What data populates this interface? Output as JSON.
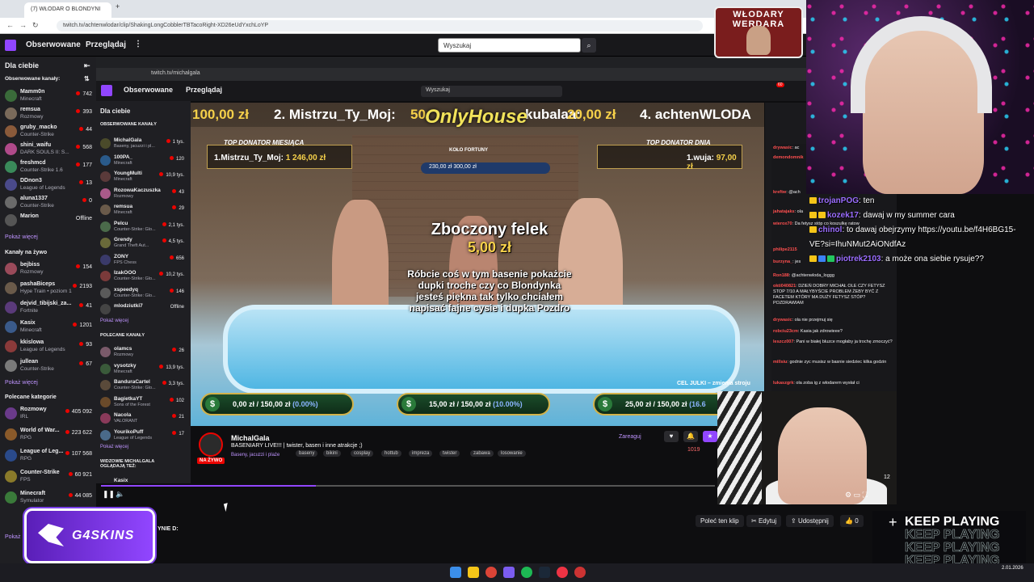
{
  "browser": {
    "tab_title": "(7) WŁODAR O BLONDYNI",
    "url": "twitch.tv/achtenwlodar/clip/ShakingLongCobblerTBTacoRight-XD26eUdYxchLoYP",
    "new_tab": "+"
  },
  "twitch_nav": {
    "following": "Obserwowane",
    "browse": "Przeglądaj",
    "more": "⋮",
    "search_placeholder": "Wyszukaj"
  },
  "sidebar": {
    "for_you": "Dla ciebie",
    "collapse": "⇤",
    "followed_label": "Obserwowane kanały:",
    "followed": [
      {
        "name": "Mamm0n",
        "game": "Minecraft",
        "viewers": "742",
        "color": "#3a6b3a"
      },
      {
        "name": "remsua",
        "game": "Rozmowy",
        "viewers": "393",
        "color": "#7a6a5a"
      },
      {
        "name": "gruby_macko",
        "game": "Counter-Strike",
        "viewers": "44",
        "color": "#8a5a3a"
      },
      {
        "name": "shini_waifu",
        "game": "DARK SOULS II: S...",
        "viewers": "568",
        "color": "#b04a8a"
      },
      {
        "name": "freshmcd",
        "game": "Counter-Strike 1.6",
        "viewers": "177",
        "color": "#3a8a5a"
      },
      {
        "name": "DDnon3",
        "game": "League of Legends",
        "viewers": "13",
        "color": "#4a4a8a"
      },
      {
        "name": "aluna1337",
        "game": "Counter-Strike",
        "viewers": "0",
        "color": "#6a6a6a"
      },
      {
        "name": "Marion",
        "game": "",
        "viewers": "Offline",
        "color": "#555555"
      }
    ],
    "show_more_1": "Pokaż więcej",
    "live_label": "Kanały na żywo",
    "live": [
      {
        "name": "bejbiss",
        "game": "Rozmowy",
        "viewers": "154",
        "color": "#9a4a5a"
      },
      {
        "name": "pashaBiceps",
        "game": "Hype Train • poziom 1",
        "viewers": "2193",
        "color": "#6a5a4a"
      },
      {
        "name": "dejvid_tibijski_za...",
        "game": "Fortnite",
        "viewers": "41",
        "color": "#5a3a7a"
      },
      {
        "name": "Kasix",
        "game": "Minecraft",
        "viewers": "1201",
        "color": "#3a5a8a"
      },
      {
        "name": "kkislowa",
        "game": "League of Legends",
        "viewers": "93",
        "color": "#8a3a3a"
      },
      {
        "name": "jullean",
        "game": "Counter-Strike",
        "viewers": "67",
        "color": "#7a7a7a"
      }
    ],
    "show_more_2": "Pokaż więcej",
    "categories_label": "Polecane kategorie",
    "categories": [
      {
        "name": "Rozmowy",
        "tag": "IRL",
        "viewers": "405 092",
        "color": "#6a3a8a"
      },
      {
        "name": "World of War...",
        "tag": "RPG",
        "viewers": "223 622",
        "color": "#8a5a2a"
      },
      {
        "name": "League of Leg...",
        "tag": "RPG",
        "viewers": "107 568",
        "color": "#2a4a8a"
      },
      {
        "name": "Counter-Strike",
        "tag": "FPS",
        "viewers": "60 921",
        "color": "#8a7a2a"
      },
      {
        "name": "Minecraft",
        "tag": "Symulator",
        "viewers": "44 085",
        "color": "#3a7a3a"
      }
    ],
    "show_more_3": "Pokaż"
  },
  "inner": {
    "url": "twitch.tv/michalgala",
    "following": "Obserwowane",
    "browse": "Przeglądaj",
    "search_placeholder": "Wyszukaj",
    "notif_count": "60",
    "for_you": "Dla ciebie",
    "followed_label": "OBSERWOWANE KANAŁY",
    "followed": [
      {
        "name": "MichalGala",
        "game": "Baseny, jacuzzi i pl...",
        "viewers": "1 tys.",
        "color": "#4a4a2a"
      },
      {
        "name": "100PA_",
        "game": "Minecraft",
        "viewers": "120",
        "color": "#2a5a8a"
      },
      {
        "name": "YoungMulti",
        "game": "Minecraft",
        "viewers": "10,9 tys.",
        "color": "#5a3a3a"
      },
      {
        "name": "RozowaKaczuszka",
        "game": "Rozmowy",
        "viewers": "43",
        "color": "#aa5a8a"
      },
      {
        "name": "remsua",
        "game": "Minecraft",
        "viewers": "29",
        "color": "#6a5a4a"
      },
      {
        "name": "Pelcu",
        "game": "Counter-Strike: Glo...",
        "viewers": "2,1 tys.",
        "color": "#4a6a4a"
      },
      {
        "name": "Grendy",
        "game": "Grand Theft Aut...",
        "viewers": "4,5 tys.",
        "color": "#6a6a3a"
      },
      {
        "name": "ZONY",
        "game": "FPS Chess",
        "viewers": "656",
        "color": "#3a3a6a"
      },
      {
        "name": "IzakOOO",
        "game": "Counter-Strike: Glo...",
        "viewers": "10,2 tys.",
        "color": "#7a3a3a"
      },
      {
        "name": "xspeedyq",
        "game": "Counter-Strike: Glo...",
        "viewers": "146",
        "color": "#5a5a5a"
      },
      {
        "name": "mlodziutki7",
        "game": "",
        "viewers": "Offline",
        "color": "#444444"
      }
    ],
    "show_more": "Pokaż więcej",
    "recommended_label": "POLECANE KANAŁY",
    "recommended": [
      {
        "name": "olamcs",
        "game": "Rozmowy",
        "viewers": "26",
        "color": "#7a5a6a"
      },
      {
        "name": "vysotzky",
        "game": "Minecraft",
        "viewers": "13,9 tys.",
        "color": "#3a5a3a"
      },
      {
        "name": "BanduraCartel",
        "game": "Counter-Strike: Glo...",
        "viewers": "3,3 tys.",
        "color": "#5a4a3a"
      },
      {
        "name": "BagietkaYT",
        "game": "Sons of the Forest",
        "viewers": "102",
        "color": "#6a4a2a"
      },
      {
        "name": "Nacola",
        "game": "VALORANT",
        "viewers": "21",
        "color": "#8a3a5a"
      },
      {
        "name": "YourikoPuff",
        "game": "League of Legends",
        "viewers": "17",
        "color": "#4a6a8a"
      }
    ],
    "show_more_2": "Pokaż więcej",
    "viewers_also": "WIDZOWIE MICHALGALA OGLĄDAJĄ TEŻ:",
    "viewers_also_item": "Kasix"
  },
  "stream_overlay": {
    "ticker": [
      {
        "text": "100,00 zł",
        "gold": true
      },
      {
        "text": "2. Mistrzu_Ty_Moj:",
        "gold": false
      },
      {
        "text": "50",
        "gold": true
      },
      {
        "text": "kubalaa:",
        "gold": false
      },
      {
        "text": "20,00 zł",
        "gold": true
      },
      {
        "text": "4. achtenWLODA",
        "gold": false
      }
    ],
    "brand": "OnlyHouse",
    "top_month_head": "TOP DONATOR MIESIĄCA",
    "top_month_name": "1.Mistrzu_Ty_Moj:",
    "top_month_amount": "1 246,00 zł",
    "top_day_head": "TOP DONATOR DNIA",
    "top_day_name": "1.wuja:",
    "top_day_amount": "97,00 zł",
    "wheel_label": "KOŁO FORTUNY",
    "wheel_values": "230,00 zł   300,00 zł",
    "donor_name": "Zboczony felek",
    "donor_amount": "5,00 zł",
    "donor_message": "Róbcie coś w tym basenie pokażcie dupki troche czy co Blondynka jesteś piękna tak tylko chciałem napisać fajne cysie i dupka Pozdro",
    "goal_cel": "CEL JULKI – zmienia stroju",
    "goals": [
      {
        "value": "0,00 zł / 150,00 zł",
        "pct": "(0.00%)"
      },
      {
        "value": "15,00 zł / 150,00 zł",
        "pct": "(10.00%)"
      },
      {
        "value": "25,00 zł / 150,00 zł",
        "pct": "(16.6"
      }
    ]
  },
  "stream_info": {
    "channel": "MichalGala",
    "title": "BASENIARY LIVE!!! | twister, basen i inne atrakcje ;)",
    "category": "Baseny, jacuzzi i plaże",
    "tags": [
      "baseny",
      "bikini",
      "cosplay",
      "hottub",
      "impreza",
      "twister",
      "zabawa",
      "losowanie"
    ],
    "live_label": "NA ŻYWO",
    "follow": "Zareaguj",
    "viewers": "1019",
    "progress_fraction": 0.35
  },
  "bottom_actions": {
    "recommend": "Poleć ten klip",
    "edit": "Edytuj",
    "share": "Udostępnij",
    "likes": "0",
    "partial_text": "YNIE D:"
  },
  "chat": [
    {
      "user": "trojanPOG",
      "text": ": ten",
      "badges": [
        "y"
      ]
    },
    {
      "user": "kozek17",
      "text": ": dawaj w my summer cara",
      "badges": [
        "y",
        "y"
      ]
    },
    {
      "user": "chinol",
      "text": ": to dawaj obejrzymy https://youtu.be/f4H6BG15-",
      "badges": [
        "y"
      ]
    },
    {
      "user": "",
      "text": "VE?si=IhuNMut2AiONdfAz",
      "badges": []
    },
    {
      "user": "piotrek2103",
      "text": ": a może ona siebie rysuje??",
      "badges": [
        "y",
        "b",
        "g"
      ]
    }
  ],
  "inner_chat": [
    {
      "user": "drywasic",
      "text": ": ac"
    },
    {
      "user": "demondomnik",
      "text": ""
    },
    {
      "user": "kreftw",
      "text": ": @ach"
    },
    {
      "user": "jahatajaks",
      "text": ": ola"
    },
    {
      "user": "wierox70",
      "text": ": Da fetysz stóp co koszulkę ratow"
    },
    {
      "user": "philipe2115",
      "text": ""
    },
    {
      "user": "burzyna_",
      "text": ": jes"
    },
    {
      "user": "Ron188",
      "text": ": @achtenwloda_loggg"
    },
    {
      "user": "okti040821",
      "text": ": DZIEŃ DOBRY MICHAŁ OLE CZY FETYSZ STOP 7/10 A MAŁYBYŚCIE PROBLEM ŻEBY BYĆ Z FACETEM KTÓRY MA DUŻY FETYSZ STÓP? POZDRAWIAM"
    },
    {
      "user": "drywasic",
      "text": ": ola nie przejmuj się"
    },
    {
      "user": "robciu23cm",
      "text": ": Kasia jak zdrowieee?"
    },
    {
      "user": "leszcz007",
      "text": ": Pani w białej bluzce mogłaby ja trochę zmoczyć?"
    },
    {
      "user": "millsiu",
      "text": ": godnie zyc musisz w basnie siedziec kilka godzin"
    },
    {
      "user": "lukaszgrk",
      "text": ": ola zoba ig z wlodarem wysłał ci"
    }
  ],
  "small_cam_counter": "12",
  "wlodary_logo": "WŁODARY WERDARA",
  "sponsor": "G4SKINS",
  "keep_playing": "KEEP PLAYING",
  "taskbar_date": "2.01.2026",
  "colors": {
    "twitch_purple": "#9146ff",
    "live_red": "#eb0400",
    "gold": "#f5d04a"
  }
}
